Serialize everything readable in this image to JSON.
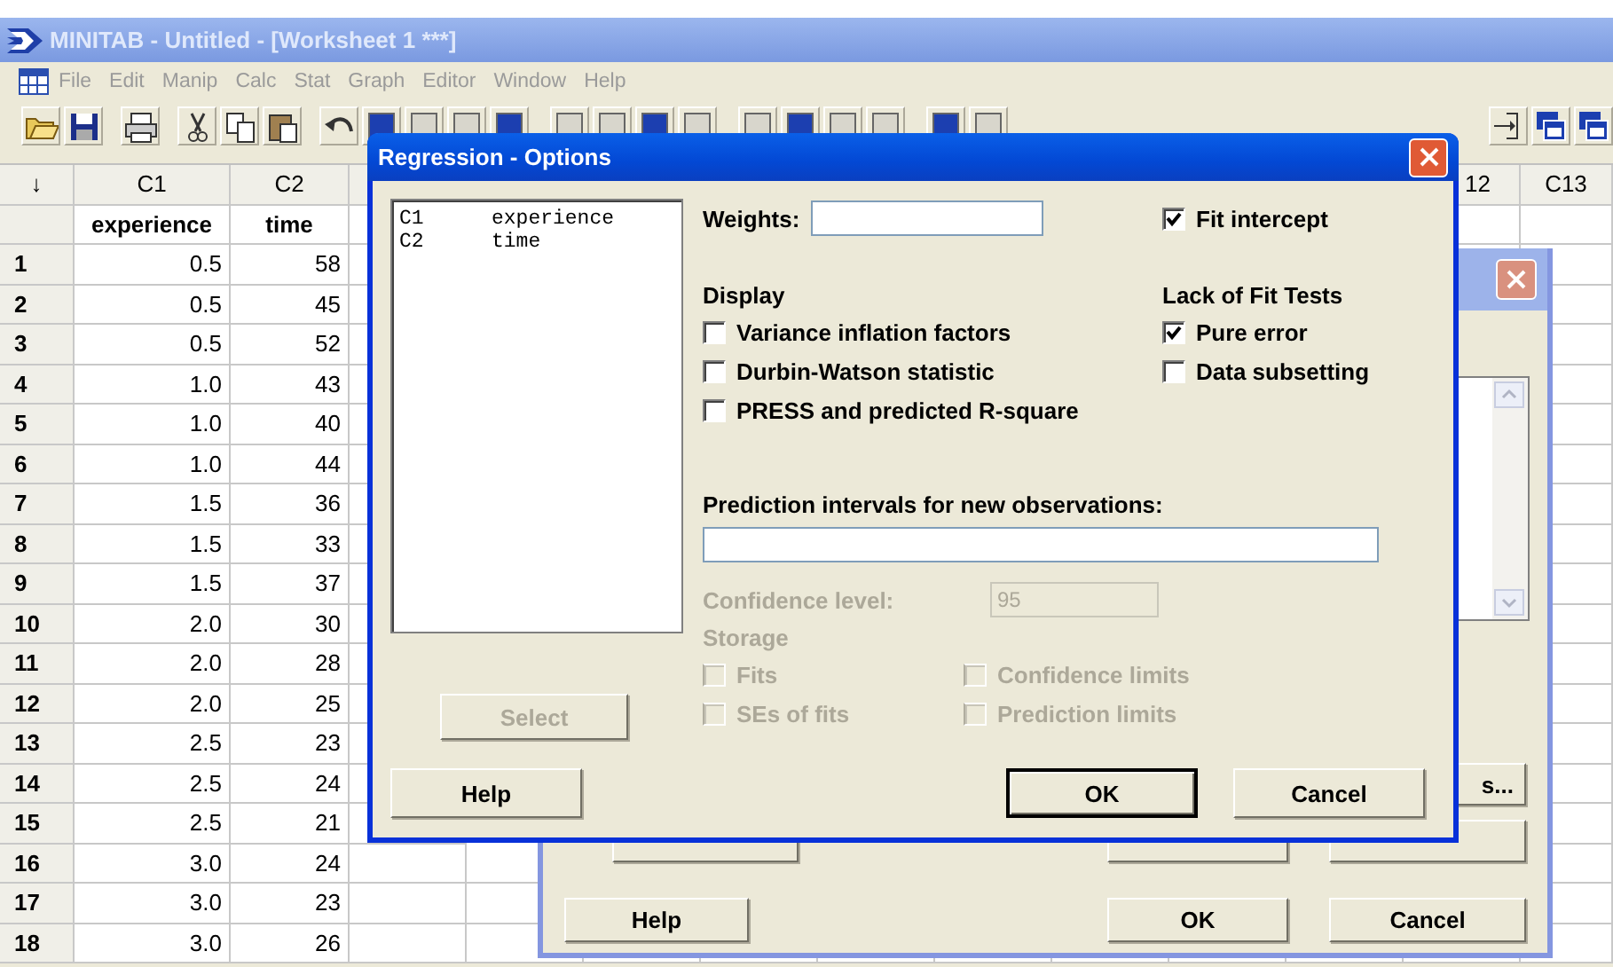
{
  "app": {
    "title": "MINITAB - Untitled - [Worksheet 1 ***]",
    "menu": [
      "File",
      "Edit",
      "Manip",
      "Calc",
      "Stat",
      "Graph",
      "Editor",
      "Window",
      "Help"
    ]
  },
  "worksheet": {
    "columns": [
      {
        "label": "↓"
      },
      {
        "label": "C1",
        "name": "experience"
      },
      {
        "label": "C2",
        "name": "time"
      },
      {
        "label": "12"
      },
      {
        "label": "C13"
      }
    ],
    "rows": [
      {
        "number": "1",
        "values": [
          "0.5",
          "58"
        ]
      },
      {
        "number": "2",
        "values": [
          "0.5",
          "45"
        ]
      },
      {
        "number": "3",
        "values": [
          "0.5",
          "52"
        ]
      },
      {
        "number": "4",
        "values": [
          "1.0",
          "43"
        ]
      },
      {
        "number": "5",
        "values": [
          "1.0",
          "40"
        ]
      },
      {
        "number": "6",
        "values": [
          "1.0",
          "44"
        ]
      },
      {
        "number": "7",
        "values": [
          "1.5",
          "36"
        ]
      },
      {
        "number": "8",
        "values": [
          "1.5",
          "33"
        ]
      },
      {
        "number": "9",
        "values": [
          "1.5",
          "37"
        ]
      },
      {
        "number": "10",
        "values": [
          "2.0",
          "30"
        ]
      },
      {
        "number": "11",
        "values": [
          "2.0",
          "28"
        ]
      },
      {
        "number": "12",
        "values": [
          "2.0",
          "25"
        ]
      },
      {
        "number": "13",
        "values": [
          "2.5",
          "23"
        ]
      },
      {
        "number": "14",
        "values": [
          "2.5",
          "24"
        ]
      },
      {
        "number": "15",
        "values": [
          "2.5",
          "21"
        ]
      },
      {
        "number": "16",
        "values": [
          "3.0",
          "24"
        ]
      },
      {
        "number": "17",
        "values": [
          "3.0",
          "23"
        ]
      },
      {
        "number": "18",
        "values": [
          "3.0",
          "26"
        ]
      }
    ]
  },
  "regression_dialog": {
    "option_button": "s...",
    "buttons": [
      "Help",
      "OK",
      "Cancel"
    ]
  },
  "options_dialog": {
    "title": "Regression - Options",
    "variables": [
      {
        "column": "C1",
        "name": "experience"
      },
      {
        "column": "C2",
        "name": "time"
      }
    ],
    "weights_label": "Weights:",
    "fit_intercept": {
      "label": "Fit intercept",
      "checked": true
    },
    "display": {
      "heading": "Display",
      "options": [
        {
          "label": "Variance inflation factors",
          "checked": false
        },
        {
          "label": "Durbin-Watson statistic",
          "checked": false
        },
        {
          "label": "PRESS and predicted R-square",
          "checked": false
        }
      ]
    },
    "lack_of_fit": {
      "heading": "Lack of Fit Tests",
      "options": [
        {
          "label": "Pure error",
          "checked": true
        },
        {
          "label": "Data subsetting",
          "checked": false
        }
      ]
    },
    "prediction_label": "Prediction intervals for new observations:",
    "confidence": {
      "label": "Confidence level:",
      "value": "95",
      "disabled": true
    },
    "storage": {
      "heading": "Storage",
      "disabled": true,
      "options": [
        {
          "label": "Fits",
          "checked": false
        },
        {
          "label": "Confidence limits",
          "checked": false
        },
        {
          "label": "SEs of fits",
          "checked": false
        },
        {
          "label": "Prediction limits",
          "checked": false
        }
      ]
    },
    "select_button": {
      "label": "Select",
      "disabled": true
    },
    "buttons": [
      {
        "label": "Help",
        "default": false
      },
      {
        "label": "OK",
        "default": true
      },
      {
        "label": "Cancel",
        "default": false
      }
    ]
  }
}
